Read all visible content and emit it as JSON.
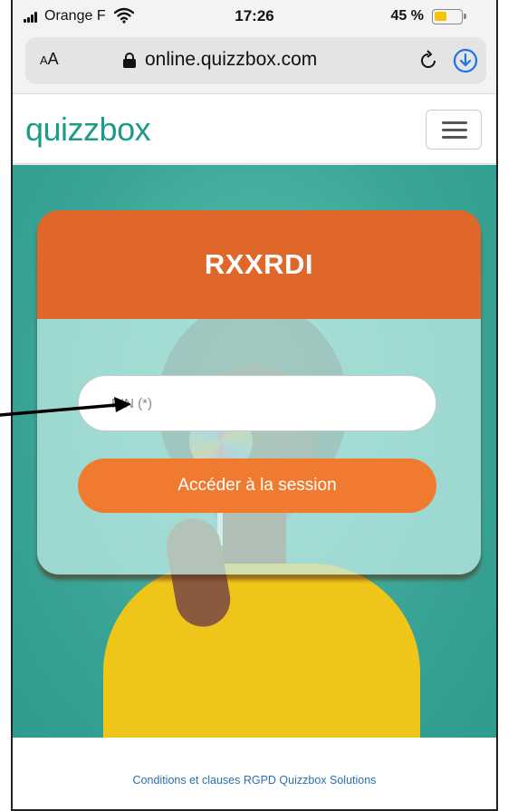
{
  "status_bar": {
    "carrier": "Orange F",
    "time": "17:26",
    "battery_percent": "45 %",
    "battery_level": 0.45,
    "battery_color": "#f5c400"
  },
  "browser": {
    "aa_label_small": "A",
    "aa_label_large": "A",
    "url": "online.quizzbox.com",
    "icons": [
      "lock-icon",
      "reload-icon",
      "download-icon"
    ]
  },
  "site": {
    "logo_text": "quizzbox",
    "logo_color": "#1e9a8b",
    "menu_icon": "hamburger-icon"
  },
  "card": {
    "session_code": "RXXRDI",
    "header_color": "#e0672a",
    "pin_placeholder": "PIN (*)",
    "access_button_label": "Accéder à la session",
    "button_color": "#f07a30"
  },
  "footer": {
    "link_text": "Conditions et clauses RGPD Quizzbox Solutions"
  }
}
